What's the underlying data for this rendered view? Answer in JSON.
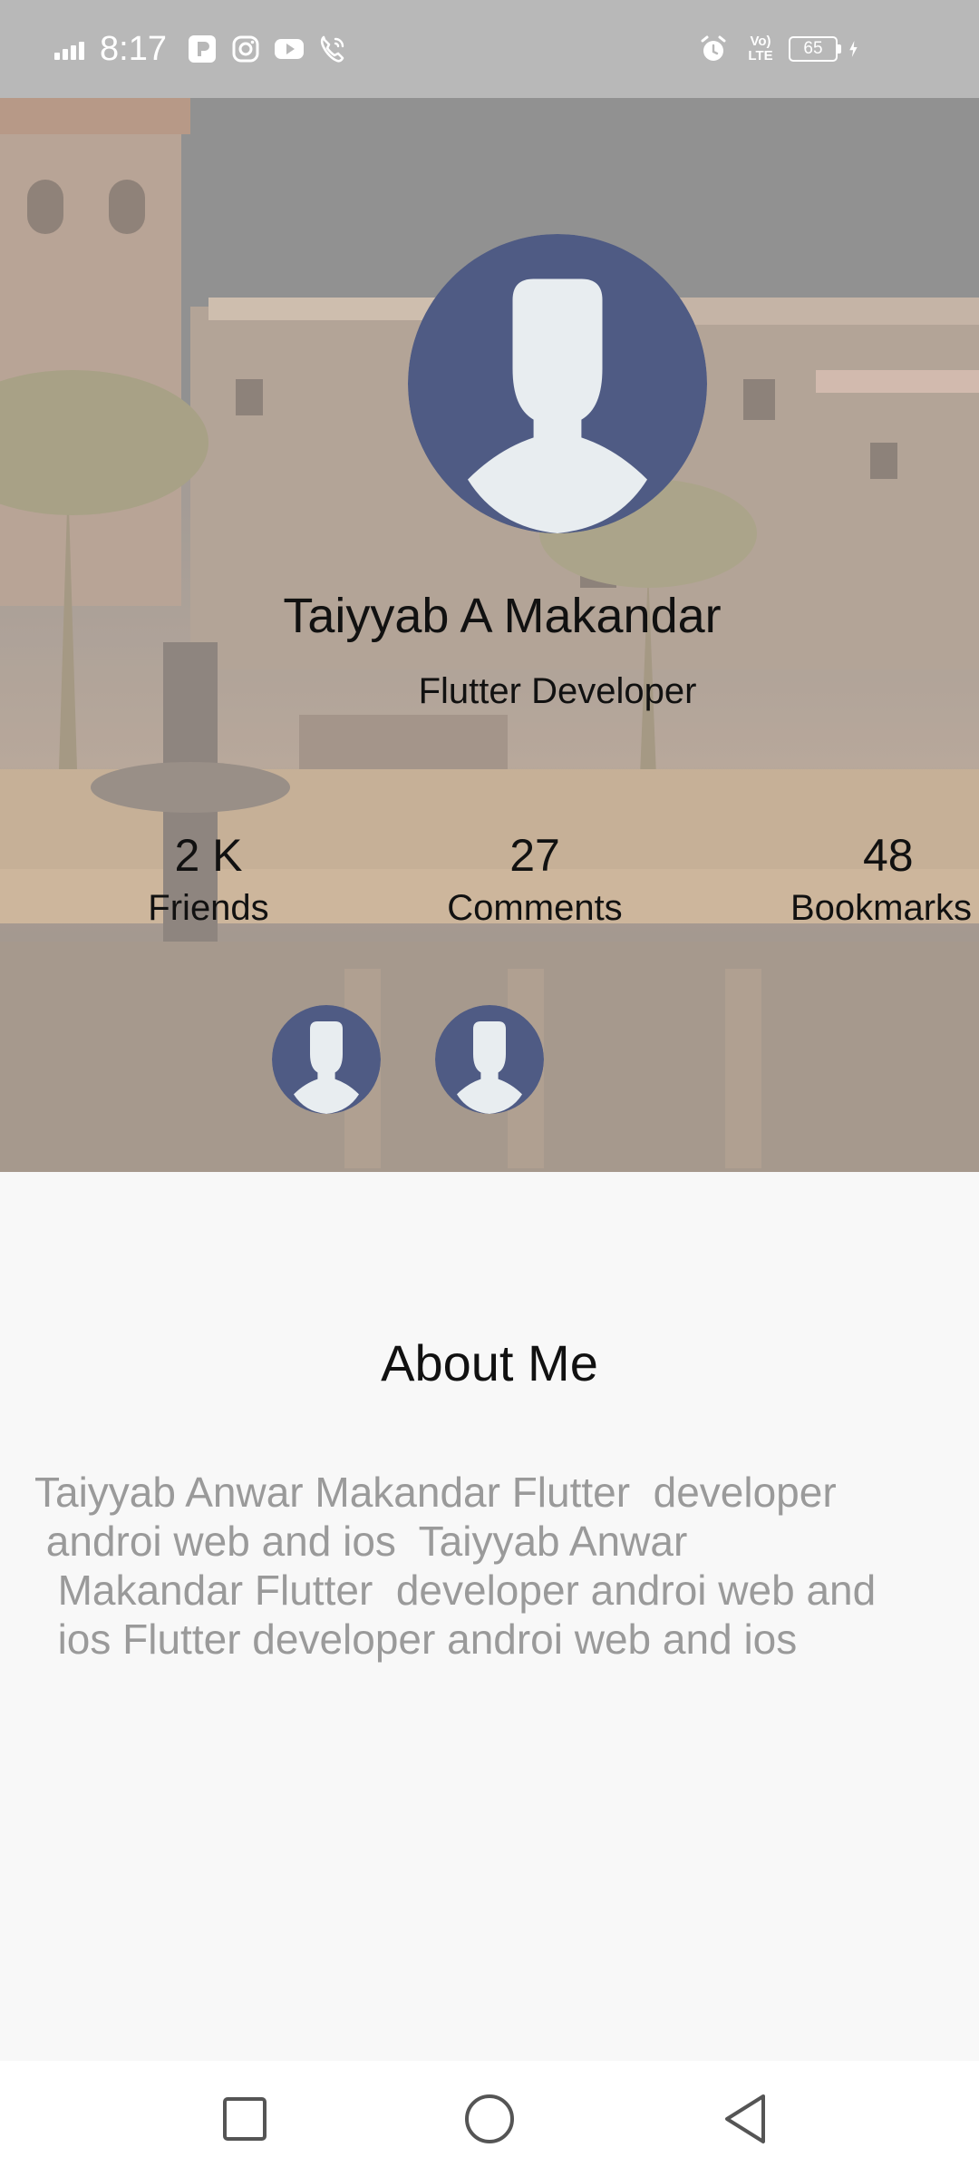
{
  "status_bar": {
    "time": "8:17",
    "battery": "65",
    "network": "Vo) LTE",
    "icons": [
      "p-app-icon",
      "instagram-icon",
      "youtube-icon",
      "wifi-call-icon",
      "alarm-icon",
      "charging-icon"
    ]
  },
  "profile": {
    "name": "Taiyyab A Makandar",
    "title": "Flutter Developer",
    "stats": [
      {
        "value": "2 K",
        "label": "Friends"
      },
      {
        "value": "27",
        "label": "Comments"
      },
      {
        "value": "48",
        "label": "Bookmarks"
      }
    ]
  },
  "about": {
    "heading": "About Me",
    "text": "Taiyyab Anwar Makandar Flutter  developer\n androi web and ios  Taiyyab Anwar\n  Makandar Flutter  developer androi web and\n  ios Flutter developer androi web and ios"
  },
  "colors": {
    "avatar_bg": "#4f5b84",
    "avatar_figure": "#e8edf0",
    "status_bar": "#b8b8b8",
    "about_text": "#9a9a9a"
  },
  "nav": {
    "icons": [
      "recents-icon",
      "home-icon",
      "back-icon"
    ]
  }
}
